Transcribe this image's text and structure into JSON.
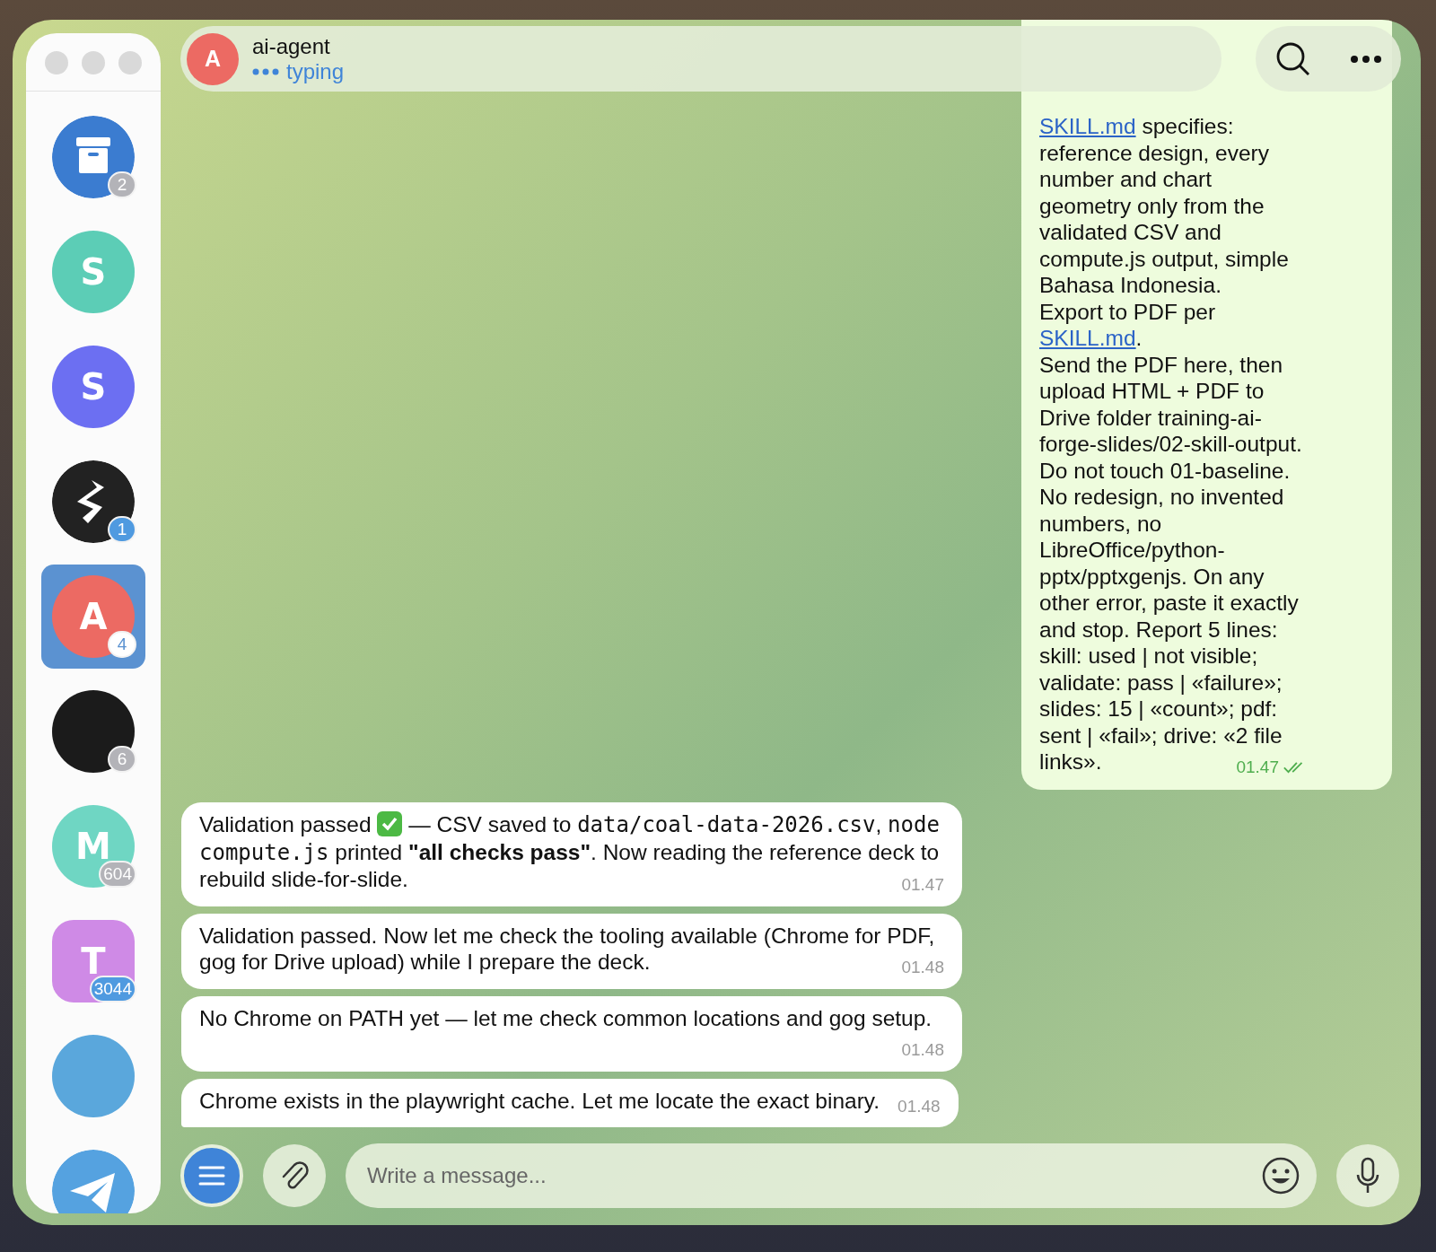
{
  "sidebar": {
    "items": [
      {
        "kind": "archive",
        "color": "#3b7cd0",
        "badge": "2",
        "muted": true,
        "selected": false
      },
      {
        "kind": "letter",
        "letter": "S",
        "color": "#5ccdb6",
        "selected": false
      },
      {
        "kind": "letter",
        "letter": "S",
        "color": "#6c6ff2",
        "selected": false
      },
      {
        "kind": "logo",
        "color": "#222222",
        "badge": "1",
        "muted": false,
        "selected": false
      },
      {
        "kind": "letter",
        "letter": "A",
        "color": "#ec6a63",
        "badge": "4",
        "muted": false,
        "selected": true
      },
      {
        "kind": "photo",
        "color": "#1b1b1b",
        "badge": "6",
        "muted": true,
        "selected": false
      },
      {
        "kind": "letter",
        "letter": "M",
        "color": "#6fd6c3",
        "badge": "604",
        "muted": true,
        "selected": false
      },
      {
        "kind": "forum",
        "letter": "T",
        "color": "#cf8ae6",
        "badge": "3044",
        "muted": false,
        "selected": false
      },
      {
        "kind": "photo",
        "color": "#5aa7dc",
        "selected": false
      },
      {
        "kind": "app",
        "color": "#55a2e0",
        "selected": false
      }
    ]
  },
  "header": {
    "avatar": {
      "letter": "A",
      "color": "#ec6a63"
    },
    "title": "ai-agent",
    "status": "typing"
  },
  "outgoing": {
    "paragraphs": [
      [
        {
          "text": "SKILL.md",
          "link": true
        },
        {
          "text": " specifies:",
          "link": false
        }
      ],
      [
        {
          "text": "reference design, every number and chart geometry only from the validated CSV and compute.js output, simple Bahasa Indonesia.",
          "link": false
        }
      ],
      [
        {
          "text": "Export to PDF per ",
          "link": false
        },
        {
          "text": "SKILL.md",
          "link": true
        },
        {
          "text": ".",
          "link": false
        }
      ],
      [
        {
          "text": "Send the PDF here, then upload HTML + PDF to Drive folder training-ai-forge-slides/02-skill-output. Do not touch 01-baseline. No redesign, no invented numbers, no LibreOffice/python-pptx/pptxgenjs. On any other error, paste it exactly and stop. Report 5 lines: skill: used | not visible; validate: pass | «failure»; slides: 15 | «count»; pdf: sent | «fail»; drive: «2 file links».",
          "link": false
        }
      ]
    ],
    "time": "01.47",
    "read": true
  },
  "incoming": [
    {
      "parts": [
        {
          "kind": "text",
          "text": "Validation passed "
        },
        {
          "kind": "check"
        },
        {
          "kind": "text",
          "text": " — CSV saved to "
        },
        {
          "kind": "code",
          "text": "data/coal-data-2026.csv"
        },
        {
          "kind": "text",
          "text": ", "
        },
        {
          "kind": "code",
          "text": "node compute.js"
        },
        {
          "kind": "text",
          "text": " printed "
        },
        {
          "kind": "bold",
          "text": "\"all checks pass\""
        },
        {
          "kind": "text",
          "text": ". Now reading the reference deck to rebuild slide-for-slide."
        }
      ],
      "time": "01.47",
      "tail": false
    },
    {
      "parts": [
        {
          "kind": "text",
          "text": "Validation passed. Now let me check the tooling available (Chrome for PDF, gog for Drive upload) while I prepare the deck."
        }
      ],
      "time": "01.48",
      "tail": false
    },
    {
      "parts": [
        {
          "kind": "text",
          "text": "No Chrome on PATH yet — let me check common locations and gog setup."
        }
      ],
      "time": "01.48",
      "tail": false
    },
    {
      "parts": [
        {
          "kind": "text",
          "text": "Chrome exists in the playwright cache. Let me locate the exact binary."
        }
      ],
      "time": "01.48",
      "tail": true
    }
  ],
  "composer": {
    "placeholder": "Write a message..."
  }
}
